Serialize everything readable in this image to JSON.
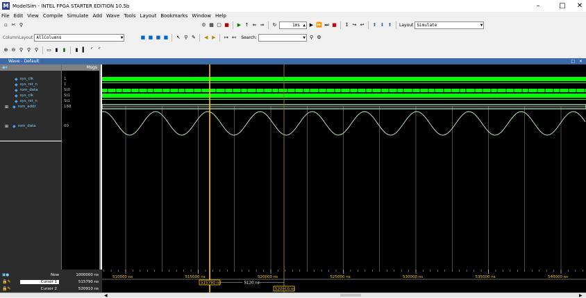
{
  "window": {
    "title": "ModelSim - INTEL FPGA STARTER EDITION 10.5b",
    "logo": "M"
  },
  "menu": [
    "File",
    "Edit",
    "View",
    "Compile",
    "Simulate",
    "Add",
    "Wave",
    "Tools",
    "Layout",
    "Bookmarks",
    "Window",
    "Help"
  ],
  "toolbar": {
    "run_length": "1ms",
    "layout_label": "Layout",
    "layout_value": "Simulate",
    "search_label": "Search:",
    "column_layout_label": "ColumnLayout",
    "column_layout_value": "AllColumns"
  },
  "wave": {
    "title": "Wave - Default",
    "header_msgs": "Msgs",
    "signals": [
      {
        "name": "sys_clk",
        "value": "1",
        "kind": "clock"
      },
      {
        "name": "sys_rst_n",
        "value": "1",
        "kind": "high"
      },
      {
        "name": "rom_data",
        "value": "St0",
        "kind": "dense"
      },
      {
        "name": "sys_clk",
        "value": "St1",
        "kind": "clock"
      },
      {
        "name": "sys_rst_n",
        "value": "St1",
        "kind": "high"
      },
      {
        "name": "rom_addr",
        "value": "188",
        "kind": "bus"
      },
      {
        "name": "rom_data",
        "value": "00",
        "kind": "analog"
      }
    ],
    "time_ticks": [
      "510000 ns",
      "515000 ns",
      "520000 ns",
      "525000 ns",
      "530000 ns",
      "535000 ns",
      "540000 ns"
    ],
    "tick_start_ns": 510000,
    "tick_step_ns": 5000,
    "now_label": "Now",
    "now_value": "1000000 ns",
    "cursors": [
      {
        "name": "Cursor 1",
        "value": "515790 ns",
        "flag": "515790 ns",
        "time_ns": 515790
      },
      {
        "name": "Cursor 2",
        "value": "520910 ns",
        "flag": "520910 ns",
        "time_ns": 520910
      }
    ],
    "delta": "5120 ns"
  },
  "colors": {
    "wave_green": "#00ff00",
    "cursor1": "#ffcc00",
    "cursor2": "#8a7a2a",
    "analog": "#c8f8c8"
  }
}
